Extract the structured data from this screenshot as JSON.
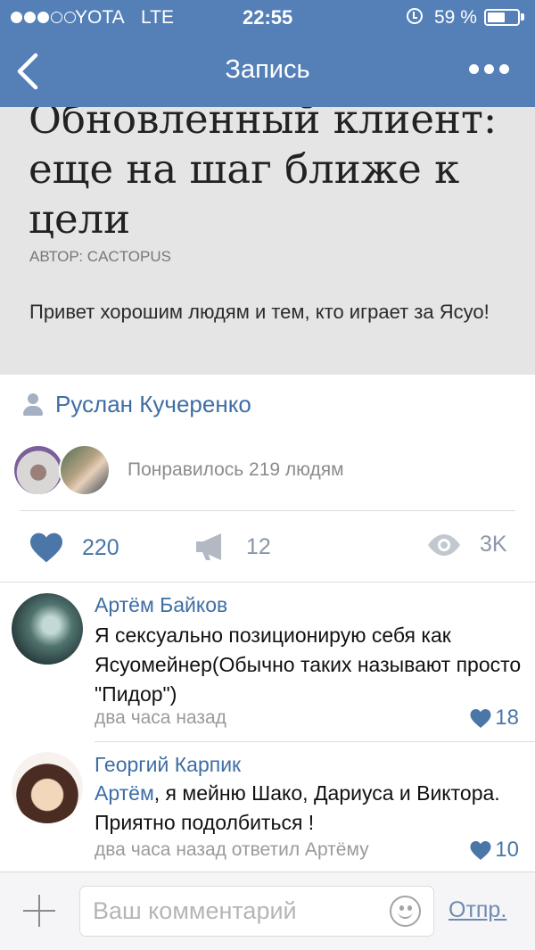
{
  "status_bar": {
    "carrier": "YOTA",
    "network": "LTE",
    "time": "22:55",
    "battery_percent": "59 %",
    "battery_level": 0.59,
    "signal_strength": 3,
    "icons": [
      "signal-dots-icon",
      "alarm-icon",
      "battery-icon"
    ]
  },
  "nav": {
    "title": "Запись",
    "back_icon": "chevron-left-icon",
    "more_icon": "more-dots-icon"
  },
  "article": {
    "title": "Обновленный клиент: еще на шаг ближе к цели",
    "author_line": "Автор: Cactopus",
    "text": "Привет хорошим людям и тем, кто играет за Ясуо!"
  },
  "post": {
    "author": "Руслан Кучеренко",
    "liked_by_text": "Понравилось 219 людям",
    "likes_count": "220",
    "shares_count": "12",
    "views_count": "3K"
  },
  "comments": [
    {
      "author": "Артём Байков",
      "text": "Я сексуально позиционирую себя как Ясуомейнер(Обычно таких называют просто \"Пидор\")",
      "meta": "два часа назад",
      "likes": "18"
    },
    {
      "author": "Георгий Карпик",
      "mention": "Артём",
      "text": ", я мейню Шако, Дариуса и Виктора. Приятно подолбиться !",
      "meta": "два часа назад ответил Артёму",
      "likes": "10"
    }
  ],
  "composer": {
    "placeholder": "Ваш комментарий",
    "send_label": "Отпр."
  },
  "colors": {
    "nav_background": "#5480b7",
    "link_blue": "#3e6ea5",
    "article_background": "#e5e5e5",
    "muted_gray": "#9a9a9a"
  }
}
